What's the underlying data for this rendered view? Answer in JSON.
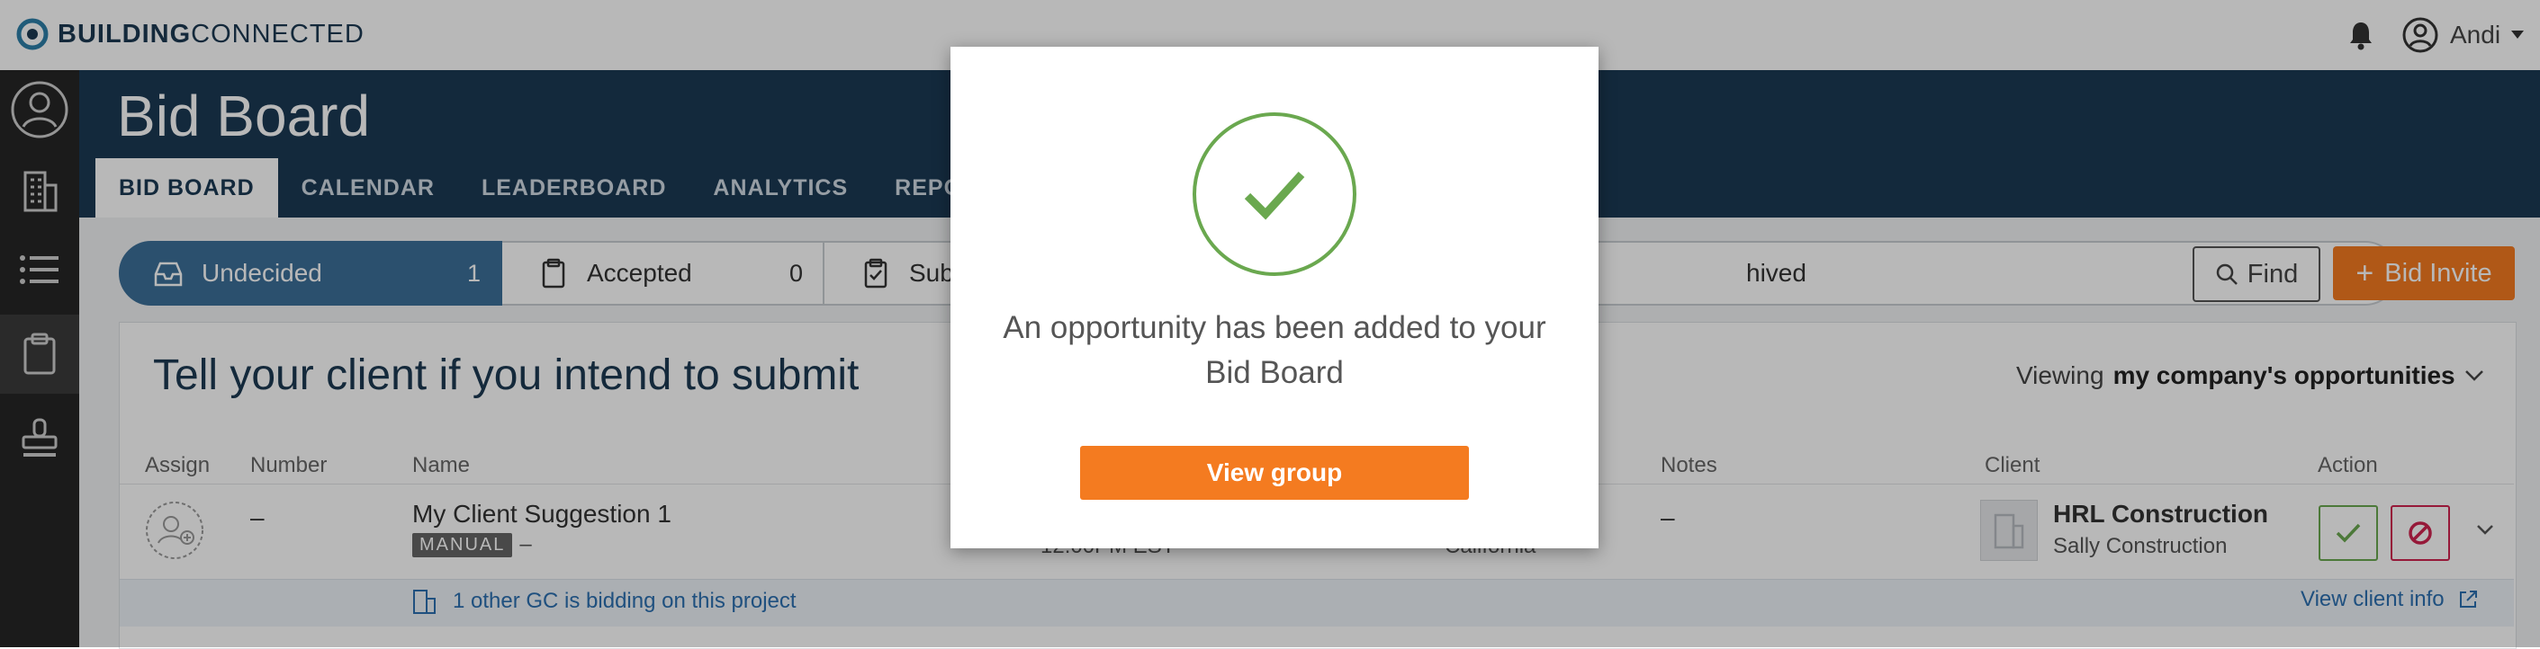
{
  "app": {
    "logo_bold": "BUILDING",
    "logo_light": "CONNECTED",
    "user_name": "Andi"
  },
  "header": {
    "title": "Bid Board",
    "tabs": [
      "BID BOARD",
      "CALENDAR",
      "LEADERBOARD",
      "ANALYTICS",
      "REPO"
    ]
  },
  "pipeline": {
    "stages": [
      {
        "label": "Undecided",
        "count": "1"
      },
      {
        "label": "Accepted",
        "count": "0"
      },
      {
        "label": "Submitted",
        "count": ""
      },
      {
        "label": "hived",
        "count": ""
      }
    ]
  },
  "toolbar": {
    "find_label": "Find",
    "bid_invite_label": "Bid Invite"
  },
  "panel": {
    "heading": "Tell your client if you intend to submit",
    "viewing_prefix": "Viewing",
    "viewing_value": "my company's opportunities"
  },
  "table": {
    "columns": [
      "Assign",
      "Number",
      "Name",
      "Notes",
      "Client",
      "Action"
    ],
    "row": {
      "number": "–",
      "name": "My Client Suggestion 1",
      "badge": "MANUAL",
      "badge_suffix": "–",
      "date_partial": "12:00PM EST",
      "location_partial": "California",
      "notes": "–",
      "client_name": "HRL Construction",
      "client_sub": "Sally Construction"
    },
    "strip": {
      "gc_text": "1 other GC is bidding on this project",
      "client_info_link": "View client info"
    }
  },
  "modal": {
    "message": "An opportunity has been added to your Bid Board",
    "button_label": "View group"
  },
  "colors": {
    "navy": "#1b3a54",
    "accent_orange": "#f47b20",
    "success_green": "#6aa84f",
    "decline_red": "#d0234f"
  }
}
